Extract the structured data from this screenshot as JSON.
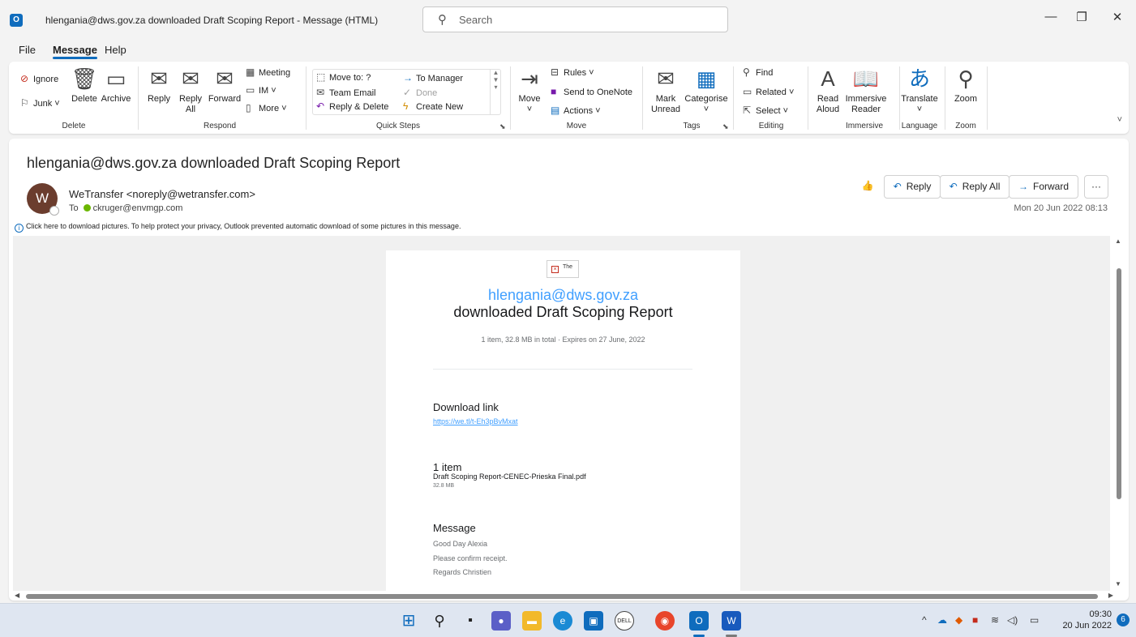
{
  "window": {
    "title": "hlengania@dws.gov.za downloaded Draft Scoping Report  -  Message (HTML)",
    "search_placeholder": "Search",
    "app_icon": "O"
  },
  "menu": [
    "File",
    "Message",
    "Help"
  ],
  "ribbon": {
    "delete": {
      "label": "Delete",
      "ignore": "Ignore",
      "junk": "Junk ˅",
      "delete": "Delete",
      "archive": "Archive"
    },
    "respond": {
      "label": "Respond",
      "reply": "Reply",
      "reply_all_1": "Reply",
      "reply_all_2": "All",
      "forward": "Forward",
      "meeting": "Meeting",
      "im": "IM ˅",
      "more": "More ˅"
    },
    "quick_steps": {
      "label": "Quick Steps",
      "move_to": "Move to: ?",
      "team_email": "Team Email",
      "reply_delete": "Reply & Delete",
      "to_manager": "To Manager",
      "done": "Done",
      "create_new": "Create New"
    },
    "move": {
      "label": "Move",
      "move": "Move",
      "rules": "Rules ˅",
      "onenote": "Send to OneNote",
      "actions": "Actions ˅"
    },
    "tags": {
      "label": "Tags",
      "mark_unread_1": "Mark",
      "mark_unread_2": "Unread",
      "categorise": "Categorise"
    },
    "editing": {
      "label": "Editing",
      "find": "Find",
      "related": "Related ˅",
      "select": "Select ˅"
    },
    "immersive": {
      "label": "Immersive",
      "read_aloud_1": "Read",
      "read_aloud_2": "Aloud",
      "reader_1": "Immersive",
      "reader_2": "Reader"
    },
    "language": {
      "label": "Language",
      "translate": "Translate"
    },
    "zoom": {
      "label": "Zoom",
      "zoom": "Zoom"
    }
  },
  "message": {
    "subject": "hlengania@dws.gov.za downloaded Draft Scoping Report",
    "avatar_initial": "W",
    "sender": "WeTransfer <noreply@wetransfer.com>",
    "to_label": "To",
    "to": "ckruger@envmgp.com",
    "date": "Mon 20 Jun 2022 08:13",
    "info_bar": "Click here to download pictures. To help protect your privacy, Outlook prevented automatic download of some pictures in this message.",
    "actions": {
      "reply": "Reply",
      "reply_all": "Reply All",
      "forward": "Forward",
      "more": "···"
    }
  },
  "email_body": {
    "logo_alt": "The",
    "downloader": "hlengania@dws.gov.za",
    "headline": "downloaded Draft Scoping Report",
    "meta": "1 item, 32.8 MB in total  ·  Expires on 27 June, 2022",
    "download_heading": "Download link",
    "download_url": "https://we.tl/t-Eh3pBvMxat",
    "items_heading": "1 item",
    "file_name": "Draft Scoping Report-CENEC-Prieska Final.pdf",
    "file_size": "32.8 MB",
    "message_heading": "Message",
    "message_lines": [
      "Good Day Alexia",
      "Please confirm receipt.",
      "Regards Christien"
    ]
  },
  "taskbar": {
    "time": "09:30",
    "date": "20 Jun 2022",
    "notifications": "6"
  },
  "colors": {
    "accent": "#0f6cbd",
    "link": "#409fff",
    "avatar": "#6b3d2e"
  }
}
